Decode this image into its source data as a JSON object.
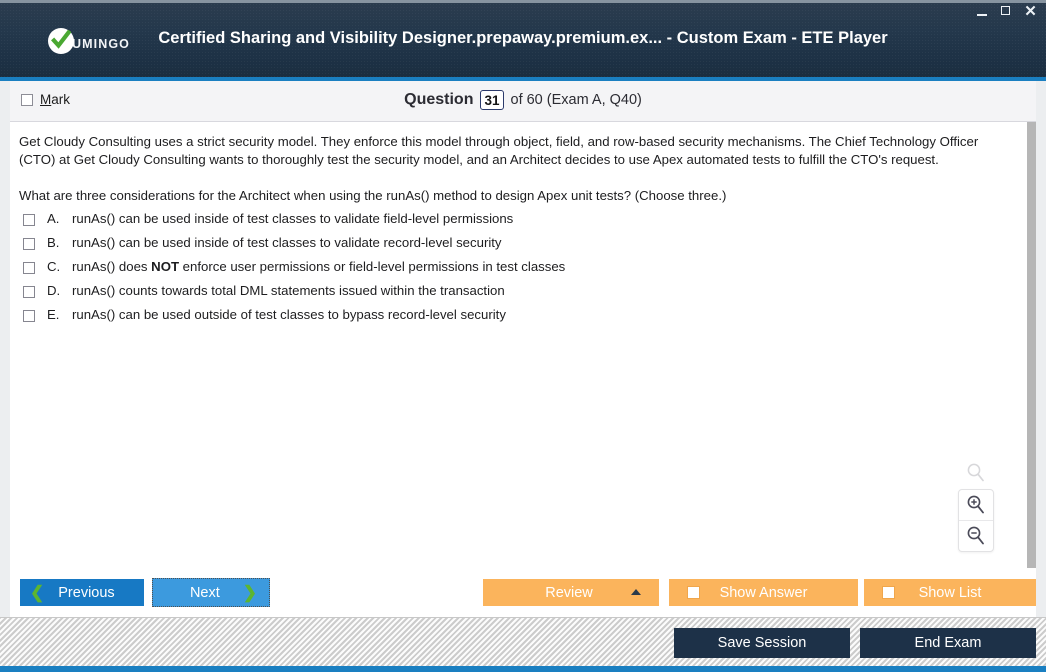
{
  "window": {
    "title": "Certified Sharing and Visibility Designer.prepaway.premium.ex... - Custom Exam - ETE Player",
    "logo_text": "UMINGO",
    "controls": {
      "minimize": "minimize-icon",
      "maximize": "maximize-icon",
      "close": "✕"
    },
    "accent_color": "#1a7fc1",
    "titlebar_color": "#1d3145"
  },
  "header": {
    "mark_label_prefix": "M",
    "mark_label_rest": "ark",
    "question_word": "Question",
    "question_number": "31",
    "question_rest": "of 60 (Exam A, Q40)"
  },
  "question": {
    "paragraph_1": "Get Cloudy Consulting uses a strict security model. They enforce this model through object, field, and row-based security mechanisms. The Chief Technology Officer (CTO) at Get Cloudy Consulting wants to thoroughly test the security model, and an Architect decides to use Apex automated tests to fulfill the CTO's request.",
    "paragraph_2": "What are three considerations for the Architect when using the runAs() method to design Apex unit tests? (Choose three.)",
    "options": [
      {
        "letter": "A.",
        "text_before": "runAs() can be used inside of test classes to validate field-level permissions",
        "bold": "",
        "text_after": "",
        "checked": false
      },
      {
        "letter": "B.",
        "text_before": "runAs() can be used inside of test classes to validate record-level security",
        "bold": "",
        "text_after": "",
        "checked": false
      },
      {
        "letter": "C.",
        "text_before": "runAs() does ",
        "bold": "NOT",
        "text_after": " enforce user permissions or field-level permissions in test classes",
        "checked": false
      },
      {
        "letter": "D.",
        "text_before": "runAs() counts towards total DML statements issued within the transaction",
        "bold": "",
        "text_after": "",
        "checked": false
      },
      {
        "letter": "E.",
        "text_before": "runAs() can be used outside of test classes to bypass record-level security",
        "bold": "",
        "text_after": "",
        "checked": false
      }
    ]
  },
  "zoom_controls": {
    "reset": "magnifier-icon",
    "zoom_in": "zoom-in-icon",
    "zoom_out": "zoom-out-icon"
  },
  "buttons": {
    "previous": "Previous",
    "next": "Next",
    "review": "Review",
    "show_answer": "Show Answer",
    "show_list": "Show List",
    "save_session": "Save Session",
    "end_exam": "End Exam",
    "primary_blue": "#1779c4",
    "next_blue": "#3c9ade",
    "orange": "#fbb45c",
    "footer_navy": "#1d3148",
    "chevron_green": "#5cb531"
  }
}
